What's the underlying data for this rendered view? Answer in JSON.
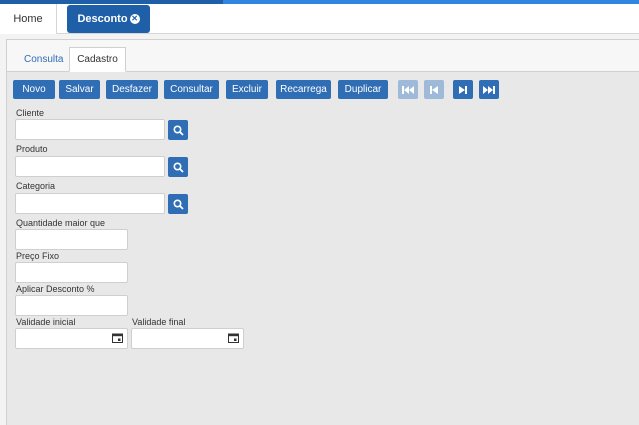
{
  "header": {
    "home_label": "Home",
    "active_tab_label": "Desconto"
  },
  "subtabs": {
    "consulta_label": "Consulta",
    "cadastro_label": "Cadastro"
  },
  "toolbar": {
    "novo": "Novo",
    "salvar": "Salvar",
    "desfazer": "Desfazer",
    "consultar": "Consultar",
    "excluir": "Excluir",
    "recarrega": "Recarrega",
    "duplicar": "Duplicar"
  },
  "form": {
    "cliente_label": "Cliente",
    "produto_label": "Produto",
    "categoria_label": "Categoria",
    "quantidade_label": "Quantidade maior que",
    "preco_label": "Preço Fixo",
    "desconto_label": "Aplicar Desconto %",
    "validade_inicial_label": "Validade inicial",
    "validade_final_label": "Validade final"
  },
  "colors": {
    "primary": "#1f5fa8",
    "button": "#2f6db5",
    "button_disabled": "#9fb9d8",
    "background": "#e8e8e8"
  }
}
